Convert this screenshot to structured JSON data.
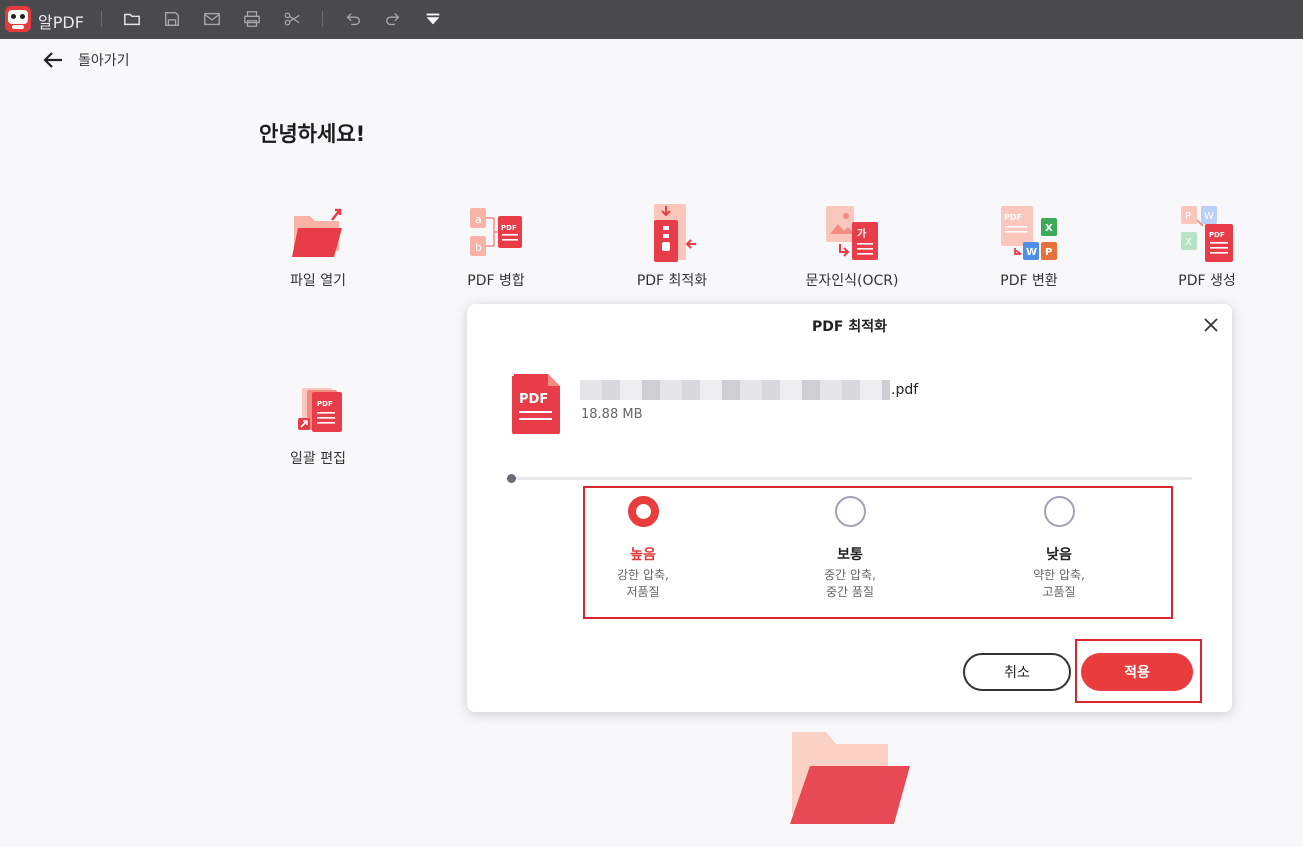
{
  "app": {
    "name": "알PDF"
  },
  "toolbar": {
    "icons": [
      "folder-icon",
      "save-icon",
      "mail-icon",
      "print-icon",
      "scissors-icon",
      "undo-icon",
      "redo-icon",
      "dropdown-icon"
    ]
  },
  "nav": {
    "back_label": "돌아가기"
  },
  "greeting": "안녕하세요!",
  "tools": [
    {
      "label": "파일 열기",
      "icon": "open-folder-icon"
    },
    {
      "label": "PDF 병합",
      "icon": "merge-icon"
    },
    {
      "label": "PDF 최적화",
      "icon": "compress-icon"
    },
    {
      "label": "문자인식(OCR)",
      "icon": "ocr-icon"
    },
    {
      "label": "PDF 변환",
      "icon": "convert-icon"
    },
    {
      "label": "PDF 생성",
      "icon": "create-icon"
    },
    {
      "label": "일괄 편집",
      "icon": "batch-edit-icon"
    }
  ],
  "dialog": {
    "title": "PDF 최적화",
    "file": {
      "extension": ".pdf",
      "size": "18.88 MB",
      "icon_label": "PDF"
    },
    "options": [
      {
        "title": "높음",
        "desc1": "강한 압축,",
        "desc2": "저품질",
        "selected": true
      },
      {
        "title": "보통",
        "desc1": "중간 압축,",
        "desc2": "중간 품질",
        "selected": false
      },
      {
        "title": "낮음",
        "desc1": "약한 압축,",
        "desc2": "고품질",
        "selected": false
      }
    ],
    "cancel_label": "취소",
    "apply_label": "적용"
  },
  "colors": {
    "accent": "#e93c3c",
    "titlebar": "#4a494e",
    "highlight_box": "#d9272e"
  }
}
